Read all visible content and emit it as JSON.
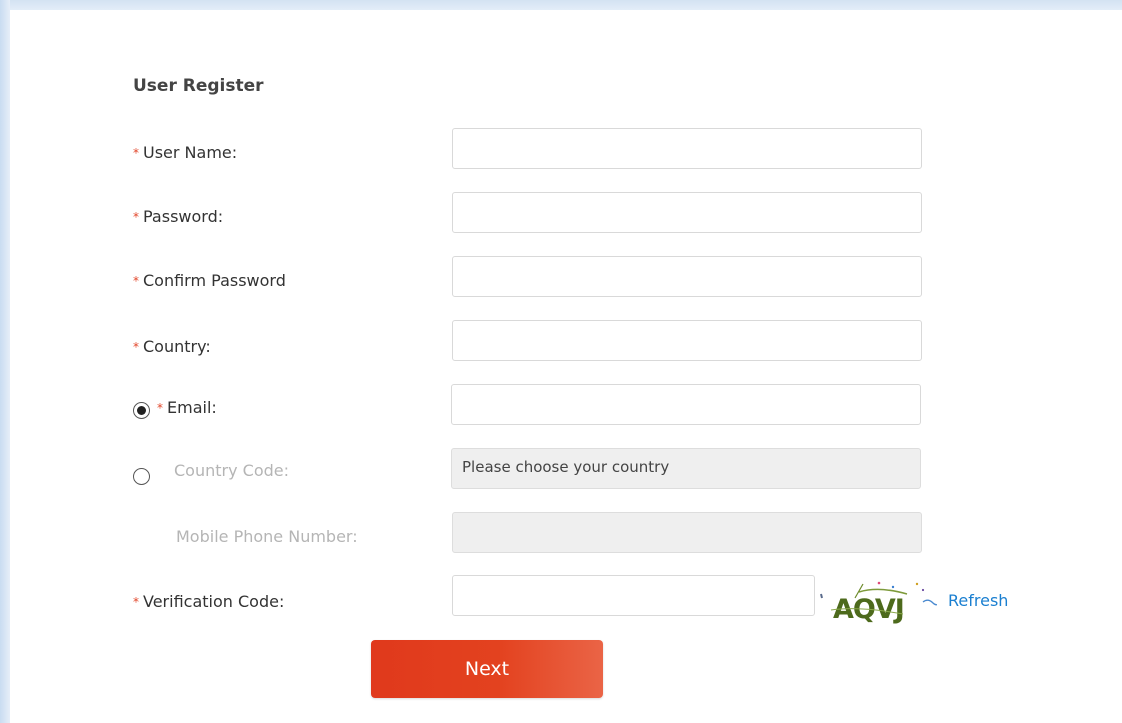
{
  "form": {
    "title": "User Register",
    "fields": {
      "user_name": {
        "label": "User Name:",
        "value": "",
        "placeholder": ""
      },
      "password": {
        "label": "Password:",
        "value": "",
        "placeholder": ""
      },
      "confirm_password": {
        "label": "Confirm Password",
        "value": "",
        "placeholder": ""
      },
      "country": {
        "label": "Country:",
        "value": "",
        "placeholder": ""
      },
      "email": {
        "label": "Email:",
        "value": "",
        "placeholder": "",
        "selected": true
      },
      "country_code": {
        "label": "Country Code:",
        "value": "Please choose your country",
        "selected": false,
        "disabled": true
      },
      "mobile_phone": {
        "label": "Mobile Phone Number:",
        "value": "",
        "placeholder": "",
        "disabled": true
      },
      "verification_code": {
        "label": "Verification Code:",
        "value": "",
        "placeholder": ""
      }
    },
    "required_marker": "*",
    "captcha": {
      "text": "AQVJ",
      "icon": "captcha-image"
    },
    "refresh_label": "Refresh",
    "next_label": "Next"
  },
  "colors": {
    "required_star": "#e2462a",
    "link": "#1a7fd0",
    "next_button": "#e0391c",
    "disabled_text": "#b5b5b5",
    "disabled_field": "#efefef"
  }
}
